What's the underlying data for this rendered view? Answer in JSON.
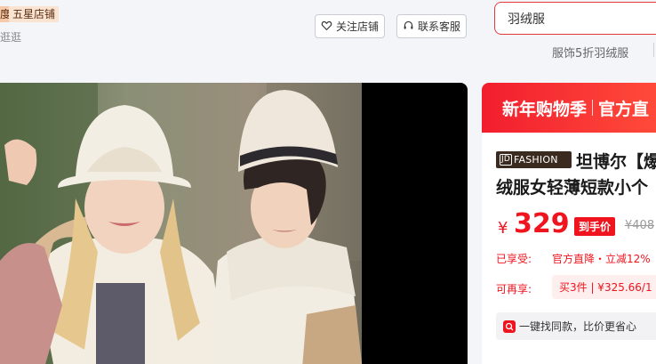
{
  "shop": {
    "rank_fragment": "度",
    "badge": "五星店铺",
    "link_fragment": "逛逛"
  },
  "header": {
    "follow_label": "关注店铺",
    "service_label": "联系客服"
  },
  "search": {
    "value": "羽绒服",
    "hot_word": "服饰5折羽绒服"
  },
  "promo": {
    "left": "新年购物季",
    "right": "官方直"
  },
  "product": {
    "brand_prefix": "JD",
    "brand_suffix": "FASHION",
    "title_line1": "坦博尔【爆",
    "title_line2": "绒服女轻薄短款小个",
    "currency": "¥",
    "price": "329",
    "price_tag": "到手价",
    "original_price": "¥408",
    "enjoyed_label": "已享受:",
    "enjoyed_value": "官方直降・立减12%",
    "available_label": "可再享:",
    "available_value": "买3件 | ¥325.66/1",
    "similar_text": "一键找同款，比价更省心"
  },
  "colors": {
    "accent_red": "#f0141e",
    "brand_dark": "#3a2a1f"
  }
}
